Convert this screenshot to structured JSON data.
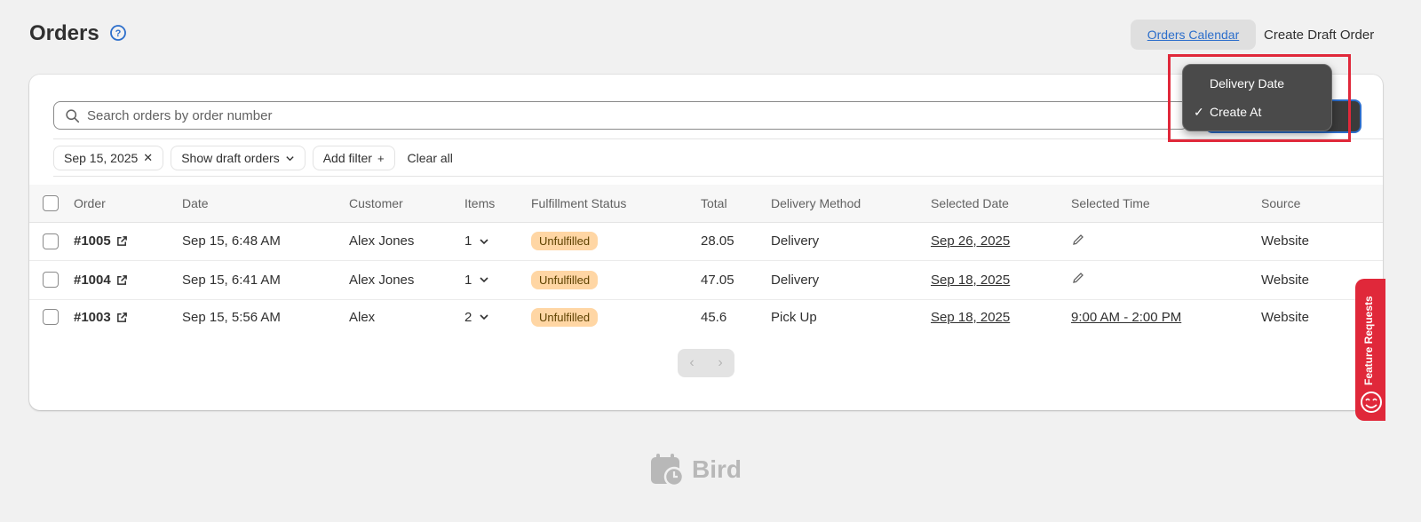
{
  "header": {
    "title": "Orders",
    "calendar_button": "Orders Calendar",
    "draft_button": "Create Draft Order"
  },
  "search": {
    "placeholder": "Search orders by order number"
  },
  "sort_menu": {
    "options": [
      "Delivery Date",
      "Create At"
    ],
    "selected": "Create At",
    "check_glyph": "✓"
  },
  "filters": {
    "date_chip": "Sep 15, 2025",
    "draft_chip": "Show draft orders",
    "add_filter": "Add filter",
    "clear_all": "Clear all"
  },
  "table": {
    "columns": [
      "Order",
      "Date",
      "Customer",
      "Items",
      "Fulfillment Status",
      "Total",
      "Delivery Method",
      "Selected Date",
      "Selected Time",
      "Source"
    ],
    "rows": [
      {
        "order": "#1005",
        "date": "Sep 15, 6:48 AM",
        "customer": "Alex Jones",
        "items": "1",
        "status": "Unfulfilled",
        "total": "28.05",
        "method": "Delivery",
        "selected_date": "Sep 26, 2025",
        "selected_time": "",
        "source": "Website"
      },
      {
        "order": "#1004",
        "date": "Sep 15, 6:41 AM",
        "customer": "Alex Jones",
        "items": "1",
        "status": "Unfulfilled",
        "total": "47.05",
        "method": "Delivery",
        "selected_date": "Sep 18, 2025",
        "selected_time": "",
        "source": "Website"
      },
      {
        "order": "#1003",
        "date": "Sep 15, 5:56 AM",
        "customer": "Alex",
        "items": "2",
        "status": "Unfulfilled",
        "total": "45.6",
        "method": "Pick Up",
        "selected_date": "Sep 18, 2025",
        "selected_time": "9:00 AM - 2:00 PM",
        "source": "Website"
      }
    ]
  },
  "pagination": {
    "prev": "‹",
    "next": "›"
  },
  "feature_tab": {
    "label": "Feature Requests"
  },
  "footer": {
    "logo_text": "Bird"
  },
  "colors": {
    "accent": "#2c6ecb",
    "badge_bg": "#ffd6a4",
    "highlight": "#e0283a"
  }
}
